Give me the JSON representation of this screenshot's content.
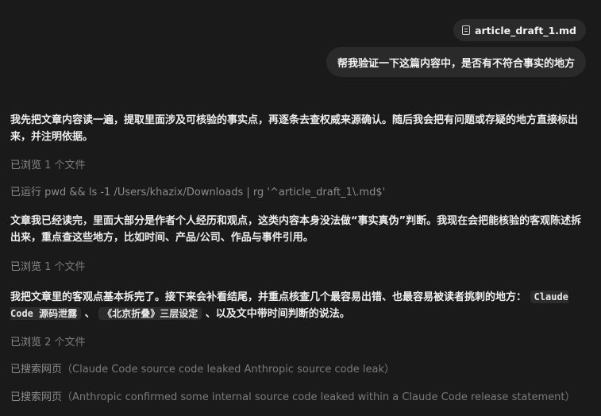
{
  "attachment": {
    "icon": "file-icon",
    "filename": "article_draft_1.md"
  },
  "user_message": "帮我验证一下这篇内容中，是否有不符合事实的地方",
  "assistant": {
    "para1": "我先把文章内容读一遍，提取里面涉及可核验的事实点，再逐条去查权威来源确认。随后我会把有问题或存疑的地方直接标出来，并注明依据。",
    "status1_label": "已浏览",
    "status1_detail": "1 个文件",
    "status2_label": "已运行",
    "status2_detail": "pwd && ls -1 /Users/khazix/Downloads | rg '^article_draft_1\\.md$'",
    "para2": "文章我已经读完，里面大部分是作者个人经历和观点，这类内容本身没法做“事实真伪”判断。我现在会把能核验的客观陈述拆出来，重点查这些地方，比如时间、产品/公司、作品与事件引用。",
    "status3_label": "已浏览",
    "status3_detail": "1 个文件",
    "para3_prefix": "我把文章里的客观点基本拆完了。接下来会补看结尾，并重点核查几个最容易出错、也最容易被读者挑刺的地方：",
    "para3_code1": "Claude Code 源码泄露",
    "para3_mid": "、",
    "para3_code2": "《北京折叠》三层设定",
    "para3_suffix": "、以及文中带时间判断的说法。",
    "status4_label": "已浏览",
    "status4_detail": "2 个文件",
    "status5_label": "已搜索网页",
    "status5_detail": "（Claude Code source code leaked Anthropic source code leak）",
    "status6_label": "已搜索网页",
    "status6_detail": "（Anthropic confirmed some internal source code leaked within a Claude Code release statement）"
  }
}
